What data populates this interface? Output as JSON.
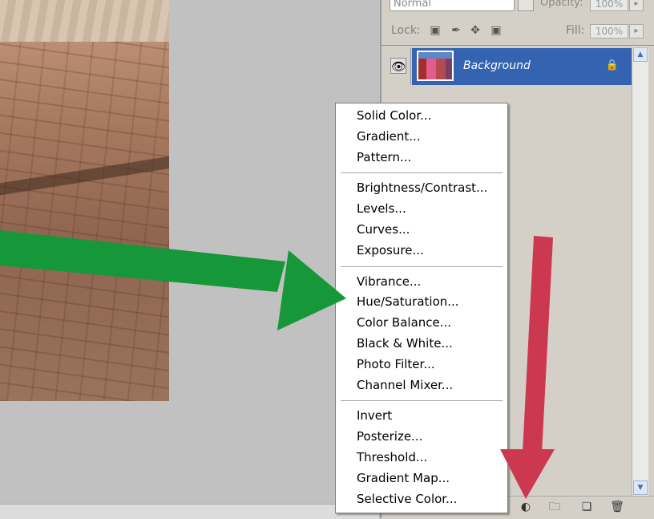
{
  "layers_panel": {
    "blend_mode": "Normal",
    "opacity_label": "Opacity:",
    "opacity_value": "100%",
    "lock_label": "Lock:",
    "fill_label": "Fill:",
    "fill_value": "100%",
    "lock_icons": [
      "lock-transparent-pixels-icon",
      "lock-image-pixels-icon",
      "lock-position-icon",
      "lock-all-icon"
    ],
    "layers": [
      {
        "name": "Background",
        "selected": true,
        "visible": true,
        "locked": true
      }
    ],
    "bottom_icons": [
      "new-adjustment-layer-icon",
      "new-group-icon",
      "new-layer-icon",
      "delete-layer-icon"
    ]
  },
  "context_menu": {
    "groups": [
      [
        "Solid Color...",
        "Gradient...",
        "Pattern..."
      ],
      [
        "Brightness/Contrast...",
        "Levels...",
        "Curves...",
        "Exposure..."
      ],
      [
        "Vibrance...",
        "Hue/Saturation...",
        "Color Balance...",
        "Black & White...",
        "Photo Filter...",
        "Channel Mixer..."
      ],
      [
        "Invert",
        "Posterize...",
        "Threshold...",
        "Gradient Map...",
        "Selective Color..."
      ]
    ]
  },
  "annotations": {
    "green_arrow_color": "#16983a",
    "red_arrow_color": "#cc3850",
    "green_arrow_target": "Hue/Saturation...",
    "red_arrow_target": "new-adjustment-layer-icon"
  },
  "colors": {
    "panel_bg": "#d4d0c8",
    "selection_blue": "#3363b1",
    "canvas_gray": "#c1c1c1"
  }
}
